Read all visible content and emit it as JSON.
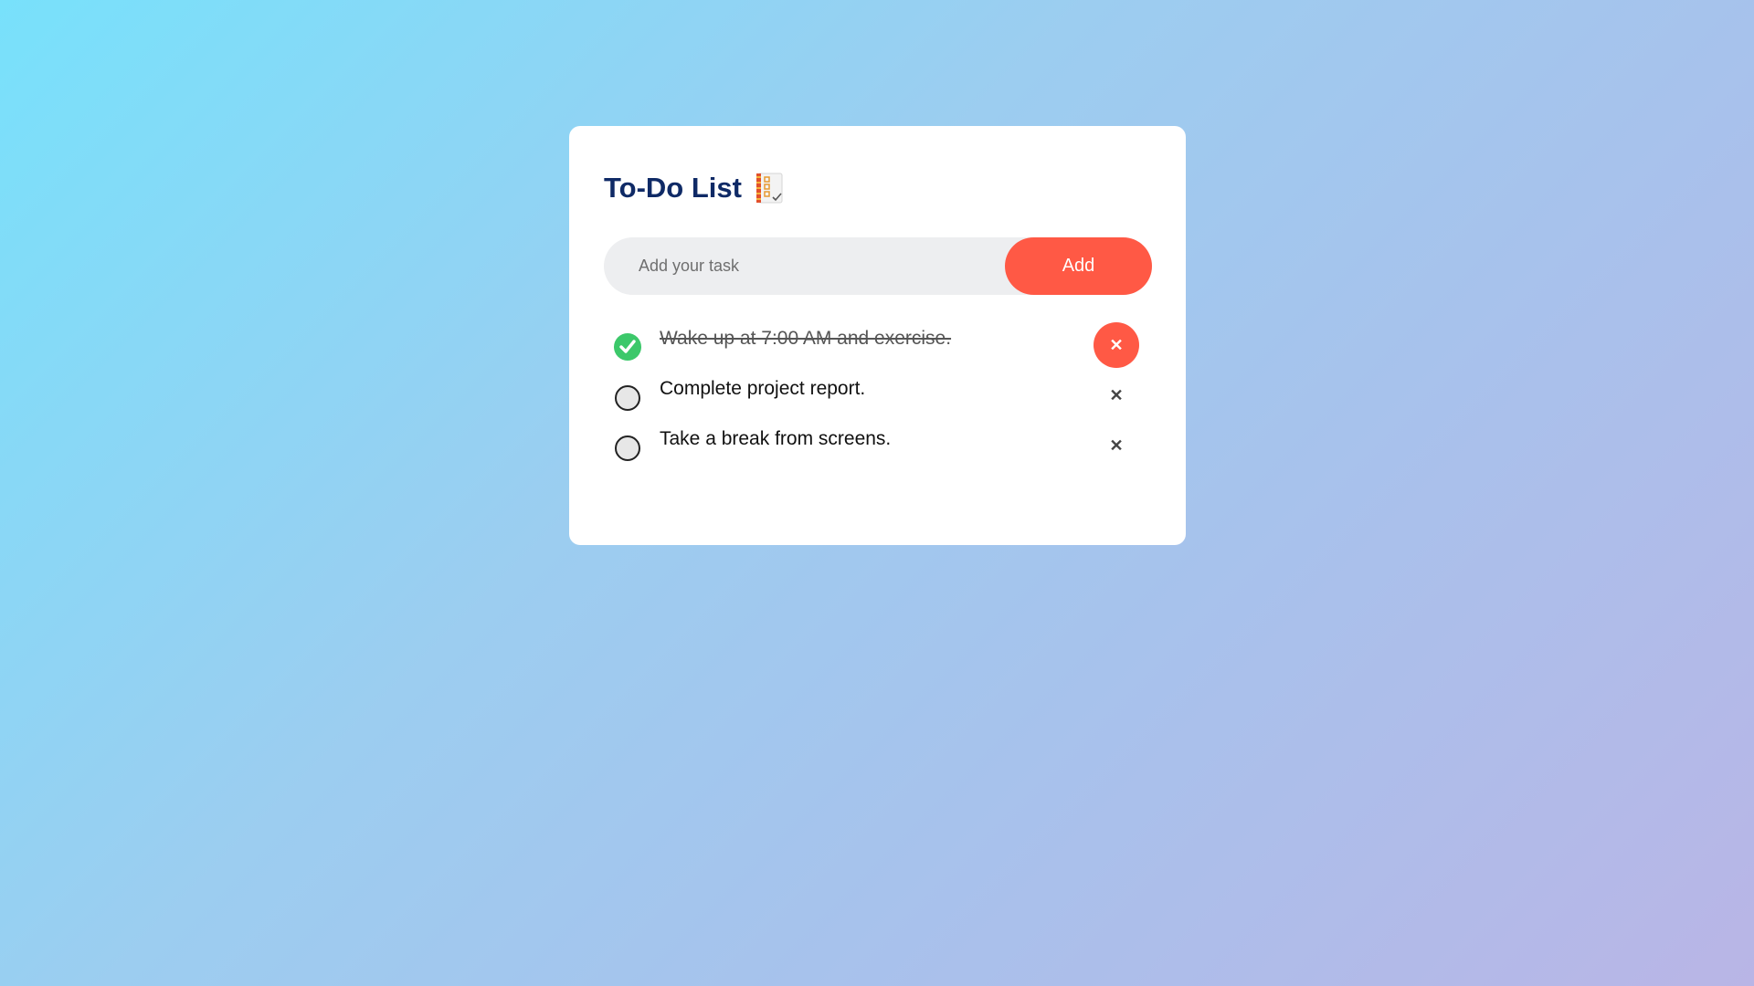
{
  "app": {
    "title": "To-Do List",
    "title_icon": "spiral-notepad-checklist-icon"
  },
  "input": {
    "placeholder": "Add your task",
    "value": ""
  },
  "add_button": {
    "label": "Add"
  },
  "tasks": [
    {
      "text": "Wake up at 7:00 AM and exercise.",
      "completed": true,
      "delete_highlighted": true
    },
    {
      "text": "Complete project report.",
      "completed": false,
      "delete_highlighted": false
    },
    {
      "text": "Take a break from screens.",
      "completed": false,
      "delete_highlighted": false
    }
  ],
  "delete_symbol": "✕",
  "colors": {
    "accent": "#ff5945",
    "title": "#0f2a66",
    "check_done": "#3cc86a",
    "input_bg": "#edeef0"
  }
}
